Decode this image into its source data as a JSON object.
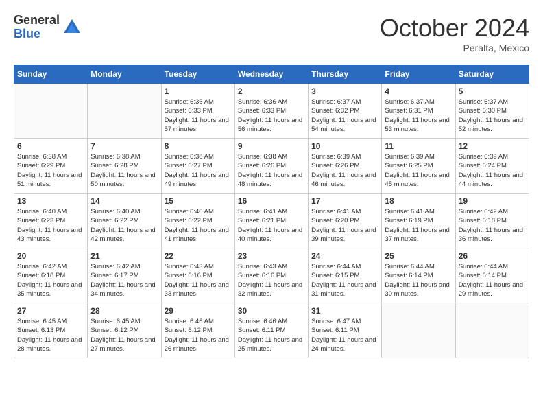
{
  "header": {
    "logo_general": "General",
    "logo_blue": "Blue",
    "month_title": "October 2024",
    "location": "Peralta, Mexico"
  },
  "days_of_week": [
    "Sunday",
    "Monday",
    "Tuesday",
    "Wednesday",
    "Thursday",
    "Friday",
    "Saturday"
  ],
  "weeks": [
    [
      {
        "day": "",
        "sunrise": "",
        "sunset": "",
        "daylight": ""
      },
      {
        "day": "",
        "sunrise": "",
        "sunset": "",
        "daylight": ""
      },
      {
        "day": "1",
        "sunrise": "Sunrise: 6:36 AM",
        "sunset": "Sunset: 6:33 PM",
        "daylight": "Daylight: 11 hours and 57 minutes."
      },
      {
        "day": "2",
        "sunrise": "Sunrise: 6:36 AM",
        "sunset": "Sunset: 6:33 PM",
        "daylight": "Daylight: 11 hours and 56 minutes."
      },
      {
        "day": "3",
        "sunrise": "Sunrise: 6:37 AM",
        "sunset": "Sunset: 6:32 PM",
        "daylight": "Daylight: 11 hours and 54 minutes."
      },
      {
        "day": "4",
        "sunrise": "Sunrise: 6:37 AM",
        "sunset": "Sunset: 6:31 PM",
        "daylight": "Daylight: 11 hours and 53 minutes."
      },
      {
        "day": "5",
        "sunrise": "Sunrise: 6:37 AM",
        "sunset": "Sunset: 6:30 PM",
        "daylight": "Daylight: 11 hours and 52 minutes."
      }
    ],
    [
      {
        "day": "6",
        "sunrise": "Sunrise: 6:38 AM",
        "sunset": "Sunset: 6:29 PM",
        "daylight": "Daylight: 11 hours and 51 minutes."
      },
      {
        "day": "7",
        "sunrise": "Sunrise: 6:38 AM",
        "sunset": "Sunset: 6:28 PM",
        "daylight": "Daylight: 11 hours and 50 minutes."
      },
      {
        "day": "8",
        "sunrise": "Sunrise: 6:38 AM",
        "sunset": "Sunset: 6:27 PM",
        "daylight": "Daylight: 11 hours and 49 minutes."
      },
      {
        "day": "9",
        "sunrise": "Sunrise: 6:38 AM",
        "sunset": "Sunset: 6:26 PM",
        "daylight": "Daylight: 11 hours and 48 minutes."
      },
      {
        "day": "10",
        "sunrise": "Sunrise: 6:39 AM",
        "sunset": "Sunset: 6:26 PM",
        "daylight": "Daylight: 11 hours and 46 minutes."
      },
      {
        "day": "11",
        "sunrise": "Sunrise: 6:39 AM",
        "sunset": "Sunset: 6:25 PM",
        "daylight": "Daylight: 11 hours and 45 minutes."
      },
      {
        "day": "12",
        "sunrise": "Sunrise: 6:39 AM",
        "sunset": "Sunset: 6:24 PM",
        "daylight": "Daylight: 11 hours and 44 minutes."
      }
    ],
    [
      {
        "day": "13",
        "sunrise": "Sunrise: 6:40 AM",
        "sunset": "Sunset: 6:23 PM",
        "daylight": "Daylight: 11 hours and 43 minutes."
      },
      {
        "day": "14",
        "sunrise": "Sunrise: 6:40 AM",
        "sunset": "Sunset: 6:22 PM",
        "daylight": "Daylight: 11 hours and 42 minutes."
      },
      {
        "day": "15",
        "sunrise": "Sunrise: 6:40 AM",
        "sunset": "Sunset: 6:22 PM",
        "daylight": "Daylight: 11 hours and 41 minutes."
      },
      {
        "day": "16",
        "sunrise": "Sunrise: 6:41 AM",
        "sunset": "Sunset: 6:21 PM",
        "daylight": "Daylight: 11 hours and 40 minutes."
      },
      {
        "day": "17",
        "sunrise": "Sunrise: 6:41 AM",
        "sunset": "Sunset: 6:20 PM",
        "daylight": "Daylight: 11 hours and 39 minutes."
      },
      {
        "day": "18",
        "sunrise": "Sunrise: 6:41 AM",
        "sunset": "Sunset: 6:19 PM",
        "daylight": "Daylight: 11 hours and 37 minutes."
      },
      {
        "day": "19",
        "sunrise": "Sunrise: 6:42 AM",
        "sunset": "Sunset: 6:18 PM",
        "daylight": "Daylight: 11 hours and 36 minutes."
      }
    ],
    [
      {
        "day": "20",
        "sunrise": "Sunrise: 6:42 AM",
        "sunset": "Sunset: 6:18 PM",
        "daylight": "Daylight: 11 hours and 35 minutes."
      },
      {
        "day": "21",
        "sunrise": "Sunrise: 6:42 AM",
        "sunset": "Sunset: 6:17 PM",
        "daylight": "Daylight: 11 hours and 34 minutes."
      },
      {
        "day": "22",
        "sunrise": "Sunrise: 6:43 AM",
        "sunset": "Sunset: 6:16 PM",
        "daylight": "Daylight: 11 hours and 33 minutes."
      },
      {
        "day": "23",
        "sunrise": "Sunrise: 6:43 AM",
        "sunset": "Sunset: 6:16 PM",
        "daylight": "Daylight: 11 hours and 32 minutes."
      },
      {
        "day": "24",
        "sunrise": "Sunrise: 6:44 AM",
        "sunset": "Sunset: 6:15 PM",
        "daylight": "Daylight: 11 hours and 31 minutes."
      },
      {
        "day": "25",
        "sunrise": "Sunrise: 6:44 AM",
        "sunset": "Sunset: 6:14 PM",
        "daylight": "Daylight: 11 hours and 30 minutes."
      },
      {
        "day": "26",
        "sunrise": "Sunrise: 6:44 AM",
        "sunset": "Sunset: 6:14 PM",
        "daylight": "Daylight: 11 hours and 29 minutes."
      }
    ],
    [
      {
        "day": "27",
        "sunrise": "Sunrise: 6:45 AM",
        "sunset": "Sunset: 6:13 PM",
        "daylight": "Daylight: 11 hours and 28 minutes."
      },
      {
        "day": "28",
        "sunrise": "Sunrise: 6:45 AM",
        "sunset": "Sunset: 6:12 PM",
        "daylight": "Daylight: 11 hours and 27 minutes."
      },
      {
        "day": "29",
        "sunrise": "Sunrise: 6:46 AM",
        "sunset": "Sunset: 6:12 PM",
        "daylight": "Daylight: 11 hours and 26 minutes."
      },
      {
        "day": "30",
        "sunrise": "Sunrise: 6:46 AM",
        "sunset": "Sunset: 6:11 PM",
        "daylight": "Daylight: 11 hours and 25 minutes."
      },
      {
        "day": "31",
        "sunrise": "Sunrise: 6:47 AM",
        "sunset": "Sunset: 6:11 PM",
        "daylight": "Daylight: 11 hours and 24 minutes."
      },
      {
        "day": "",
        "sunrise": "",
        "sunset": "",
        "daylight": ""
      },
      {
        "day": "",
        "sunrise": "",
        "sunset": "",
        "daylight": ""
      }
    ]
  ]
}
